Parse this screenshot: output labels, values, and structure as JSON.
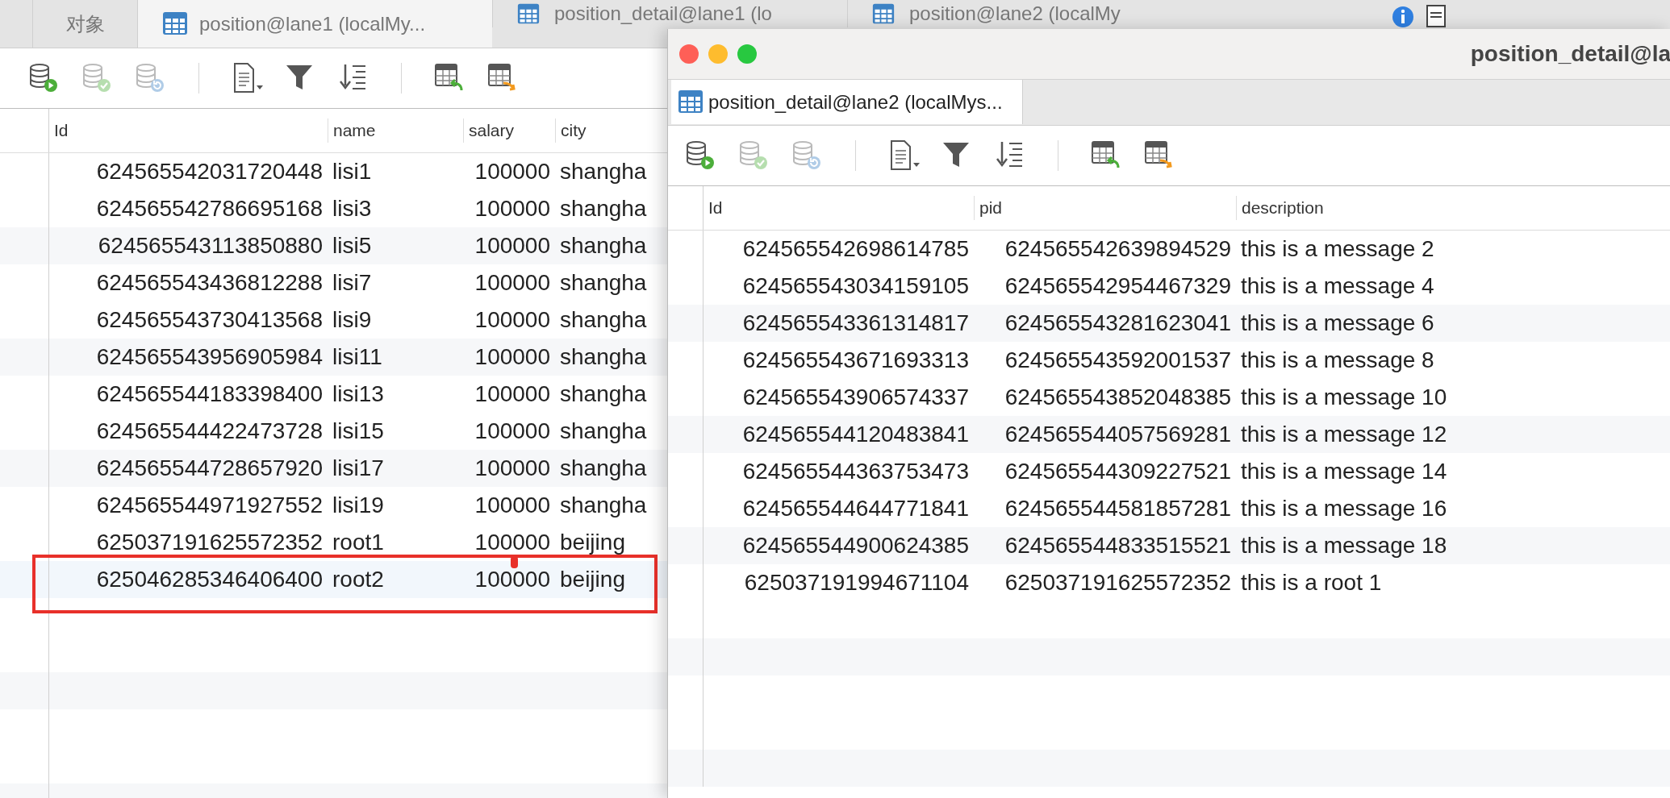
{
  "back_window": {
    "tabs": [
      {
        "label": "对象",
        "kind": "objects",
        "selected": false
      },
      {
        "label": "position@lane1 (localMy...",
        "kind": "table",
        "selected": true
      },
      {
        "label": "position_detail@lane1 (lo",
        "kind": "table",
        "selected": false
      },
      {
        "label": "position@lane2 (localMy",
        "kind": "table",
        "selected": false
      }
    ],
    "toolbar": [
      {
        "kind": "run",
        "disabled": false
      },
      {
        "kind": "apply",
        "disabled": true
      },
      {
        "kind": "refresh",
        "disabled": true
      },
      {
        "kind": "separator"
      },
      {
        "kind": "document",
        "disabled": false
      },
      {
        "kind": "filter",
        "disabled": false
      },
      {
        "kind": "sort",
        "disabled": false
      },
      {
        "kind": "separator"
      },
      {
        "kind": "table-undo",
        "disabled": false
      },
      {
        "kind": "table-export",
        "disabled": false
      }
    ],
    "table": {
      "columns": [
        {
          "label": "Id",
          "kind": "number"
        },
        {
          "label": "name",
          "kind": "text"
        },
        {
          "label": "salary",
          "kind": "number"
        },
        {
          "label": "city",
          "kind": "text"
        }
      ],
      "rows": [
        {
          "cells": [
            "624565542031720448",
            "lisi1",
            "100000",
            "shangha"
          ],
          "highlighted": false
        },
        {
          "cells": [
            "624565542786695168",
            "lisi3",
            "100000",
            "shangha"
          ],
          "highlighted": false
        },
        {
          "cells": [
            "624565543113850880",
            "lisi5",
            "100000",
            "shangha"
          ],
          "highlighted": false
        },
        {
          "cells": [
            "624565543436812288",
            "lisi7",
            "100000",
            "shangha"
          ],
          "highlighted": false
        },
        {
          "cells": [
            "624565543730413568",
            "lisi9",
            "100000",
            "shangha"
          ],
          "highlighted": false
        },
        {
          "cells": [
            "624565543956905984",
            "lisi11",
            "100000",
            "shangha"
          ],
          "highlighted": false
        },
        {
          "cells": [
            "624565544183398400",
            "lisi13",
            "100000",
            "shangha"
          ],
          "highlighted": false
        },
        {
          "cells": [
            "624565544422473728",
            "lisi15",
            "100000",
            "shangha"
          ],
          "highlighted": false
        },
        {
          "cells": [
            "624565544728657920",
            "lisi17",
            "100000",
            "shangha"
          ],
          "highlighted": false
        },
        {
          "cells": [
            "624565544971927552",
            "lisi19",
            "100000",
            "shangha"
          ],
          "highlighted": false
        },
        {
          "cells": [
            "625037191625572352",
            "root1",
            "100000",
            "beijing"
          ],
          "highlighted": false
        },
        {
          "cells": [
            "625046285346406400",
            "root2",
            "100000",
            "beijing"
          ],
          "highlighted": true
        }
      ]
    }
  },
  "front_window": {
    "title": "position_detail@la",
    "tabs": [
      {
        "label": "position_detail@lane2 (localMys...",
        "kind": "table",
        "selected": true
      }
    ],
    "toolbar": [
      {
        "kind": "run",
        "disabled": false
      },
      {
        "kind": "apply",
        "disabled": true
      },
      {
        "kind": "refresh",
        "disabled": true
      },
      {
        "kind": "separator"
      },
      {
        "kind": "document",
        "disabled": false
      },
      {
        "kind": "filter",
        "disabled": false
      },
      {
        "kind": "sort",
        "disabled": false
      },
      {
        "kind": "separator"
      },
      {
        "kind": "table-undo",
        "disabled": false
      },
      {
        "kind": "table-export",
        "disabled": false
      }
    ],
    "table": {
      "columns": [
        {
          "label": "Id",
          "kind": "number"
        },
        {
          "label": "pid",
          "kind": "number"
        },
        {
          "label": "description",
          "kind": "text"
        }
      ],
      "rows": [
        {
          "cells": [
            "624565542698614785",
            "624565542639894529",
            "this is a message 2"
          ]
        },
        {
          "cells": [
            "624565543034159105",
            "624565542954467329",
            "this is a message 4"
          ]
        },
        {
          "cells": [
            "624565543361314817",
            "624565543281623041",
            "this is a message 6"
          ]
        },
        {
          "cells": [
            "624565543671693313",
            "624565543592001537",
            "this is a message 8"
          ]
        },
        {
          "cells": [
            "624565543906574337",
            "624565543852048385",
            "this is a message 10"
          ]
        },
        {
          "cells": [
            "624565544120483841",
            "624565544057569281",
            "this is a message 12"
          ]
        },
        {
          "cells": [
            "624565544363753473",
            "624565544309227521",
            "this is a message 14"
          ]
        },
        {
          "cells": [
            "624565544644771841",
            "624565544581857281",
            "this is a message 16"
          ]
        },
        {
          "cells": [
            "624565544900624385",
            "624565544833515521",
            "this is a message 18"
          ]
        },
        {
          "cells": [
            "625037191994671104",
            "625037191625572352",
            "this is a root 1"
          ]
        }
      ]
    }
  }
}
